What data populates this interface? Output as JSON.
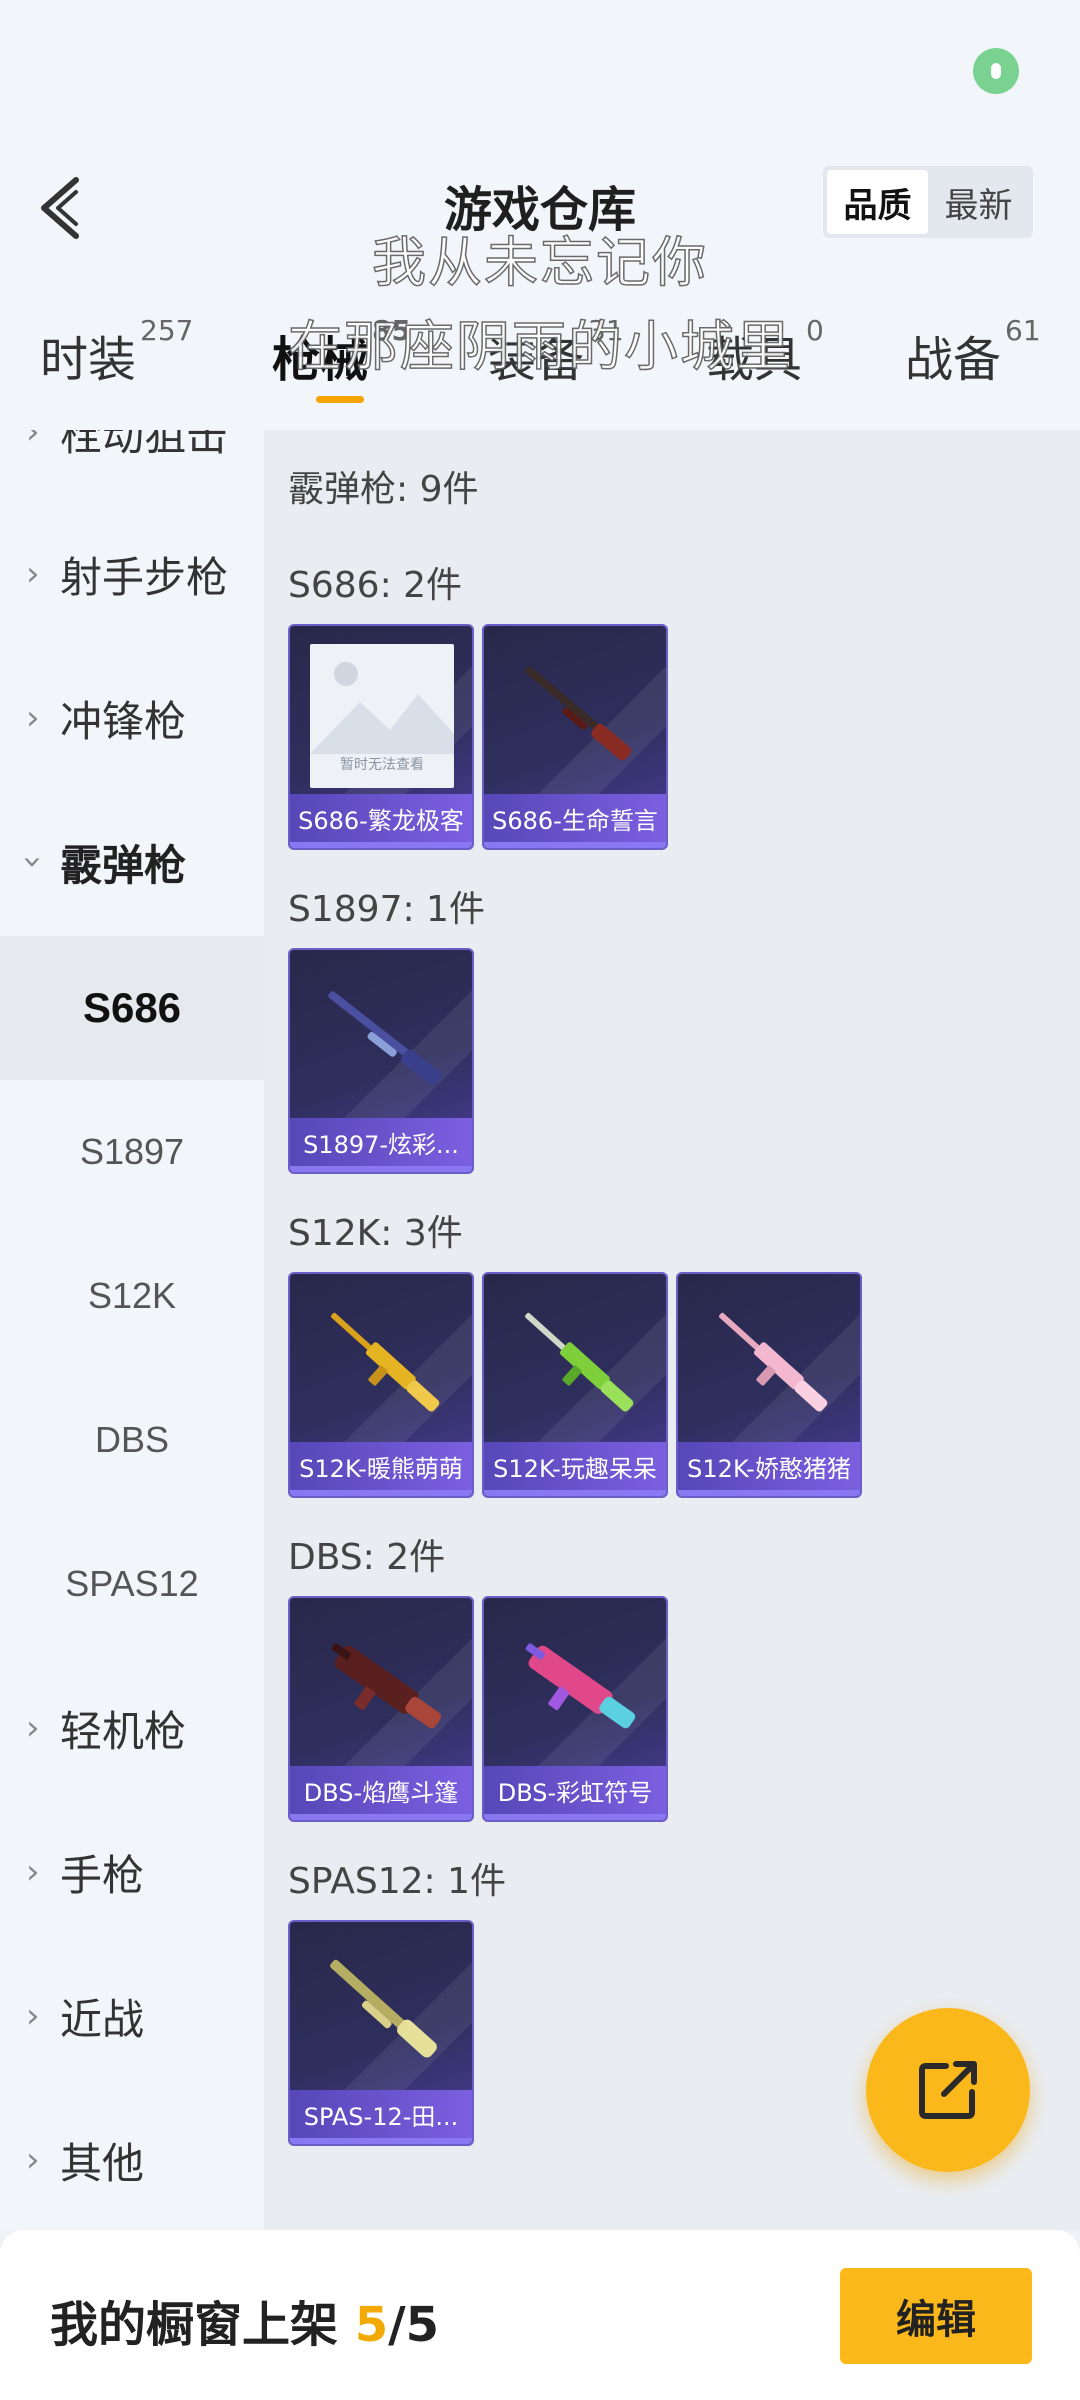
{
  "header": {
    "title": "游戏仓库",
    "sort": {
      "quality": "品质",
      "newest": "最新"
    }
  },
  "lyrics": {
    "line1": "我从未忘记你",
    "line2": "在那座阴雨的小城里"
  },
  "tabs": [
    {
      "label": "时装",
      "count": "257"
    },
    {
      "label": "枪械",
      "count": "85"
    },
    {
      "label": "装备",
      "count": "31"
    },
    {
      "label": "载具",
      "count": "0"
    },
    {
      "label": "战备",
      "count": "61"
    }
  ],
  "sidebar": {
    "items": [
      {
        "label": "栓动狙击"
      },
      {
        "label": "射手步枪"
      },
      {
        "label": "冲锋枪"
      },
      {
        "label": "霰弹枪"
      },
      {
        "label": "轻机枪"
      },
      {
        "label": "手枪"
      },
      {
        "label": "近战"
      },
      {
        "label": "其他"
      }
    ],
    "sub_items": [
      "S686",
      "S1897",
      "S12K",
      "DBS",
      "SPAS12"
    ]
  },
  "content": {
    "group_head": "霰弹枪: 9件",
    "groups": [
      {
        "head": "S686: 2件",
        "cards": [
          {
            "name": "S686-繁龙极客",
            "icon": "placeholder-image-icon",
            "placeholder_text": "暂时无法查看"
          },
          {
            "name": "S686-生命誓言",
            "icon": "shotgun-icon",
            "color": "#8a2b23"
          }
        ]
      },
      {
        "head": "S1897: 1件",
        "cards": [
          {
            "name": "S1897-炫彩...",
            "icon": "shotgun-icon",
            "color": "#3a3f8c"
          }
        ]
      },
      {
        "head": "S12K: 3件",
        "cards": [
          {
            "name": "S12K-暖熊萌萌",
            "icon": "rifle-icon",
            "color": "#e5b423"
          },
          {
            "name": "S12K-玩趣呆呆",
            "icon": "rifle-icon",
            "color": "#7ecf3a"
          },
          {
            "name": "S12K-娇憨猪猪",
            "icon": "rifle-icon",
            "color": "#f3b7cf"
          }
        ]
      },
      {
        "head": "DBS: 2件",
        "cards": [
          {
            "name": "DBS-焰鹰斗篷",
            "icon": "bullpup-icon",
            "color": "#7a2b2b"
          },
          {
            "name": "DBS-彩虹符号",
            "icon": "bullpup-icon",
            "color": "#5ad0e0"
          }
        ]
      },
      {
        "head": "SPAS12: 1件",
        "cards": [
          {
            "name": "SPAS-12-田...",
            "icon": "shotgun-icon",
            "color": "#e7e09a"
          }
        ]
      }
    ]
  },
  "bottom": {
    "shelf_label": "我的橱窗上架",
    "shelf_current": "5",
    "shelf_sep": "/",
    "shelf_total": "5",
    "edit_label": "编辑"
  },
  "colors": {
    "accent": "#fbb81a",
    "card_border": "#6c5ec8"
  }
}
